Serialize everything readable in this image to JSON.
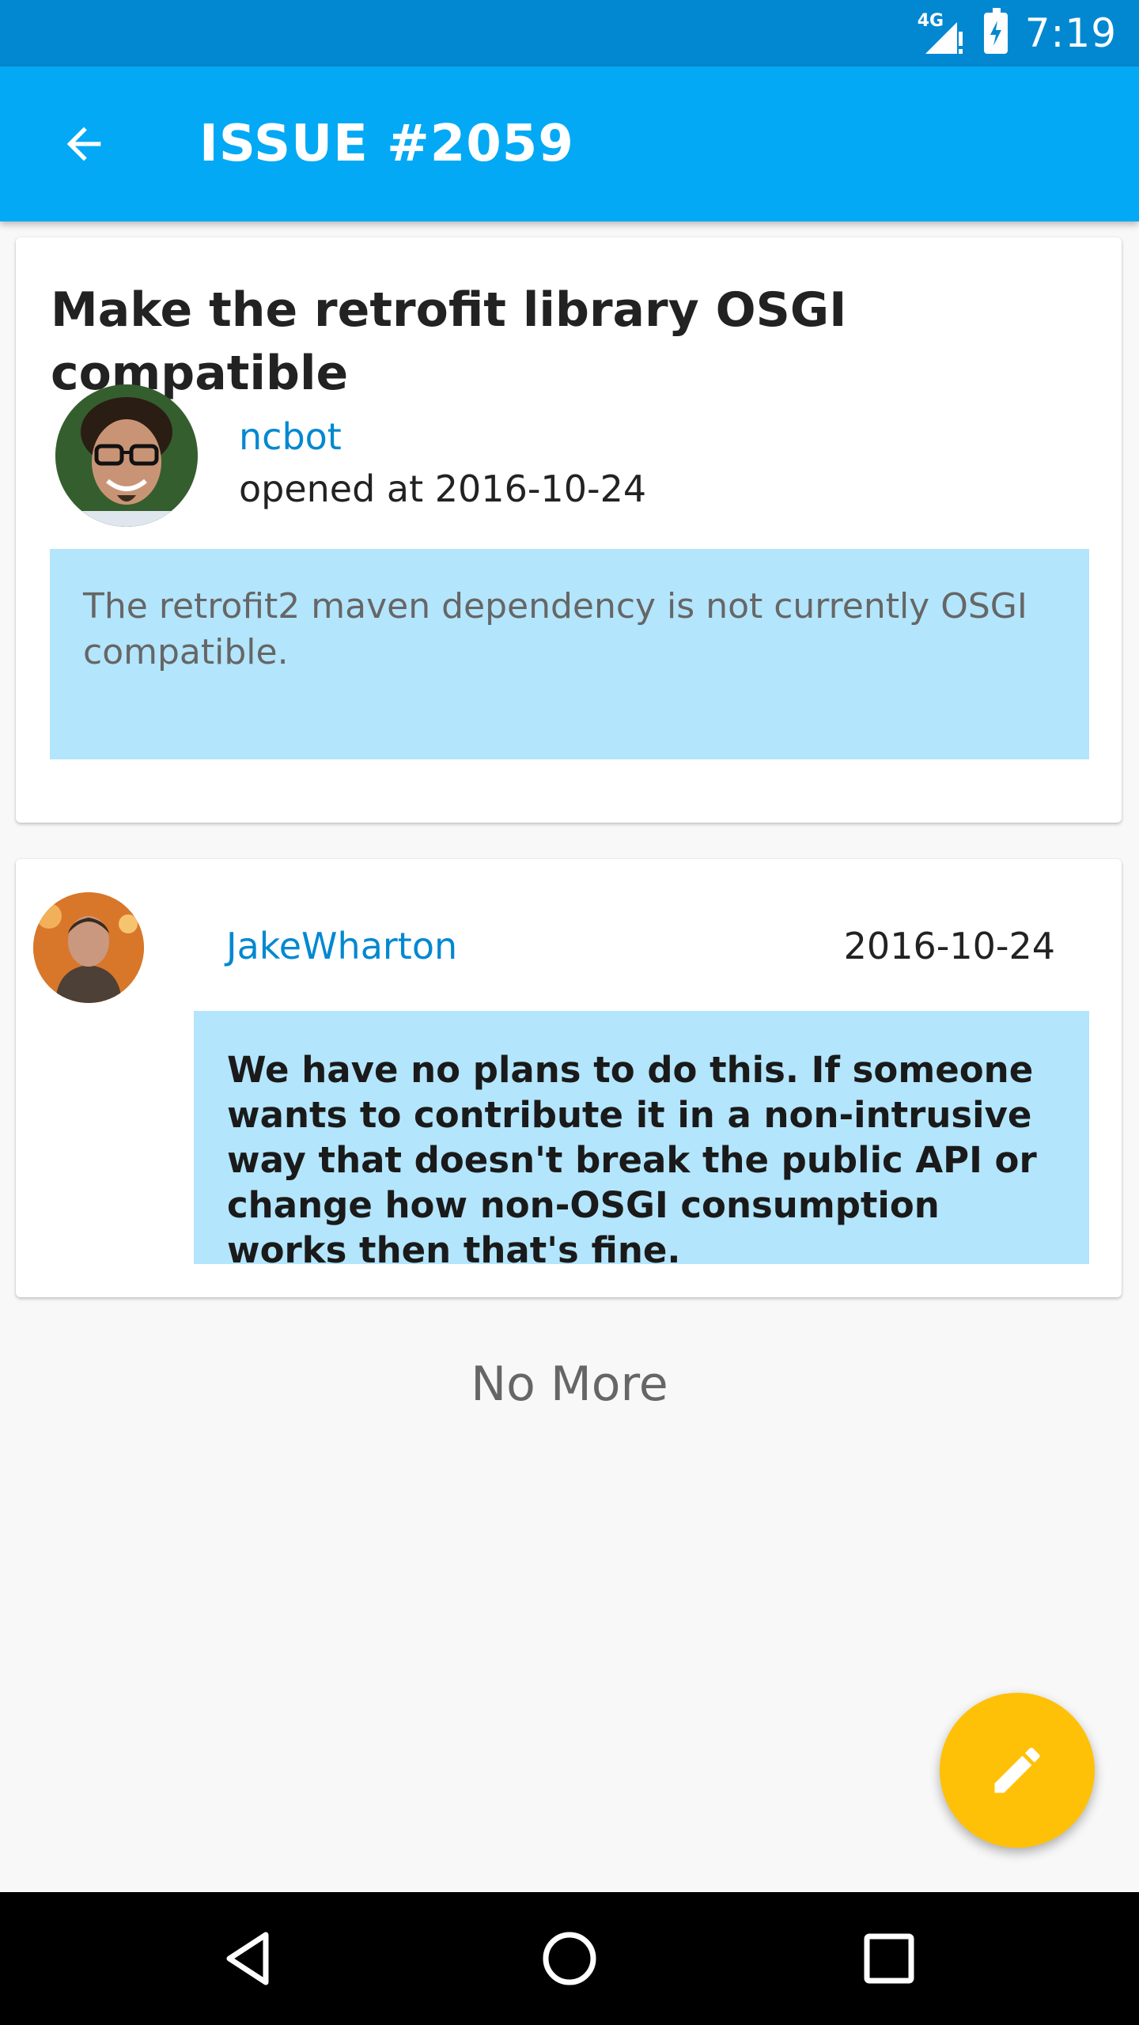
{
  "status_bar": {
    "network_label": "4G",
    "time": "7:19",
    "icons": [
      "signal-icon",
      "battery-icon"
    ]
  },
  "app_bar": {
    "title": "ISSUE #2059",
    "back_icon": "arrow-back-icon"
  },
  "issue": {
    "title": "Make the retrofit library OSGI compatible",
    "author": "ncbot",
    "opened": "opened at 2016-10-24",
    "body": "The retrofit2 maven dependency is not currently OSGI compatible."
  },
  "comments": [
    {
      "author": "JakeWharton",
      "date": "2016-10-24",
      "body": "We have no plans to do this. If someone wants to contribute it in a non-intrusive way that doesn't break the public API or change how non-OSGI consumption works then that's fine."
    }
  ],
  "footer": {
    "no_more": "No More"
  },
  "fab": {
    "icon": "pencil-icon"
  },
  "nav_bar": {
    "icons": [
      "nav-back-icon",
      "nav-home-icon",
      "nav-recent-icon"
    ]
  },
  "colors": {
    "status_bar": "#0288d1",
    "app_bar": "#03a9f4",
    "accent": "#ffc107",
    "link": "#0288d1",
    "body_box": "#b3e5fc"
  }
}
